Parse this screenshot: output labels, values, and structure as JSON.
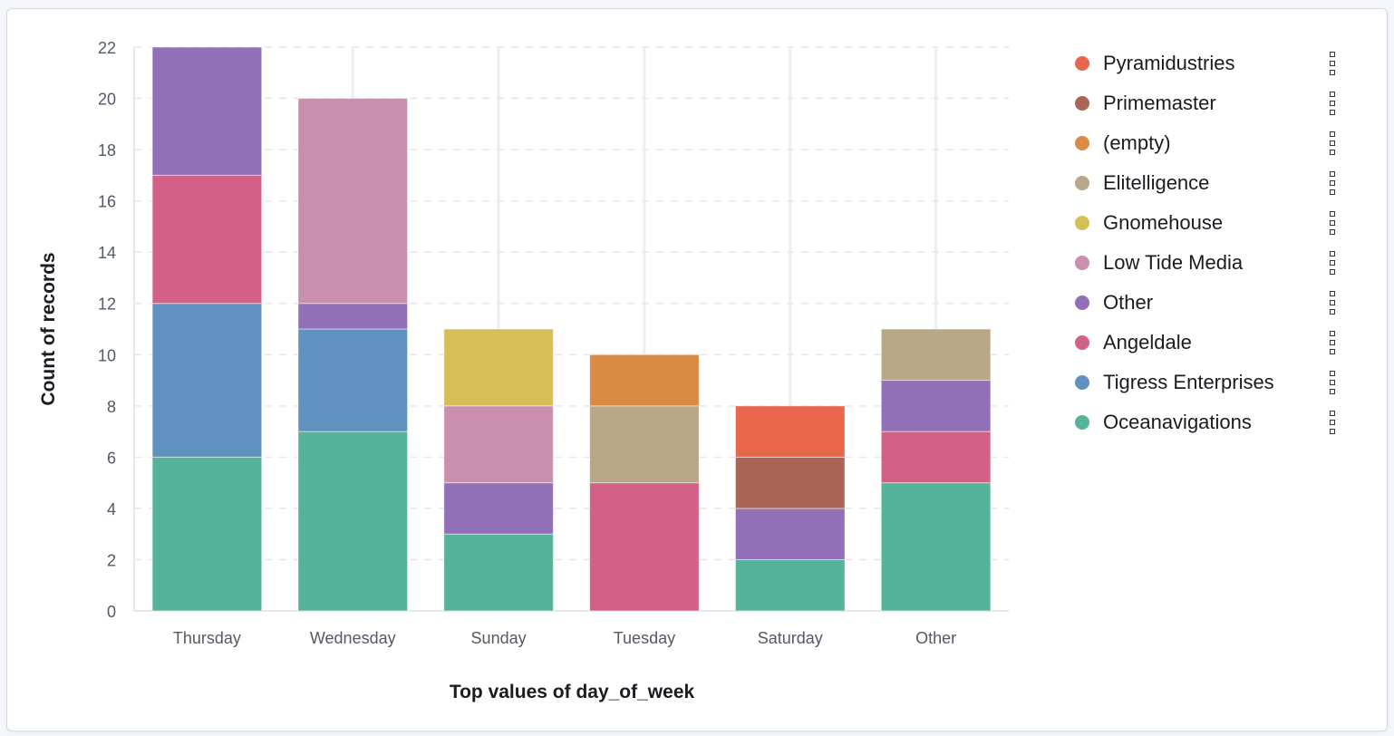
{
  "chart_data": {
    "type": "bar",
    "stacked": true,
    "title": "",
    "xlabel": "Top values of day_of_week",
    "ylabel": "Count of records",
    "ylim": [
      0,
      22
    ],
    "yticks": [
      0,
      2,
      4,
      6,
      8,
      10,
      12,
      14,
      16,
      18,
      20,
      22
    ],
    "grid": true,
    "legend_position": "right",
    "categories": [
      "Thursday",
      "Wednesday",
      "Sunday",
      "Tuesday",
      "Saturday",
      "Other"
    ],
    "series": [
      {
        "name": "Oceanavigations",
        "color": "#54b399",
        "values": [
          6,
          7,
          3,
          0,
          2,
          5
        ]
      },
      {
        "name": "Tigress Enterprises",
        "color": "#6092c0",
        "values": [
          6,
          4,
          0,
          0,
          0,
          0
        ]
      },
      {
        "name": "Angeldale",
        "color": "#d36086",
        "values": [
          5,
          0,
          0,
          5,
          0,
          2
        ]
      },
      {
        "name": "Other",
        "color": "#9170b8",
        "values": [
          5,
          1,
          2,
          0,
          2,
          2
        ]
      },
      {
        "name": "Low Tide Media",
        "color": "#ca8eae",
        "values": [
          0,
          8,
          3,
          0,
          0,
          0
        ]
      },
      {
        "name": "Gnomehouse",
        "color": "#d6bf57",
        "values": [
          0,
          0,
          3,
          0,
          0,
          0
        ]
      },
      {
        "name": "Elitelligence",
        "color": "#b9a888",
        "values": [
          0,
          0,
          0,
          3,
          0,
          2
        ]
      },
      {
        "name": "(empty)",
        "color": "#da8b45",
        "values": [
          0,
          0,
          0,
          2,
          0,
          0
        ]
      },
      {
        "name": "Primemaster",
        "color": "#aa6556",
        "values": [
          0,
          0,
          0,
          0,
          2,
          0
        ]
      },
      {
        "name": "Pyramidustries",
        "color": "#e7664c",
        "values": [
          0,
          0,
          0,
          0,
          2,
          0
        ]
      }
    ]
  },
  "legend": {
    "items": [
      {
        "label": "Pyramidustries",
        "color": "#e7664c"
      },
      {
        "label": "Primemaster",
        "color": "#aa6556"
      },
      {
        "label": "(empty)",
        "color": "#da8b45"
      },
      {
        "label": "Elitelligence",
        "color": "#b9a888"
      },
      {
        "label": "Gnomehouse",
        "color": "#d6bf57"
      },
      {
        "label": "Low Tide Media",
        "color": "#ca8eae"
      },
      {
        "label": "Other",
        "color": "#9170b8"
      },
      {
        "label": "Angeldale",
        "color": "#d36086"
      },
      {
        "label": "Tigress Enterprises",
        "color": "#6092c0"
      },
      {
        "label": "Oceanavigations",
        "color": "#54b399"
      }
    ],
    "item_menu_icon": "vertical-dots-icon"
  }
}
